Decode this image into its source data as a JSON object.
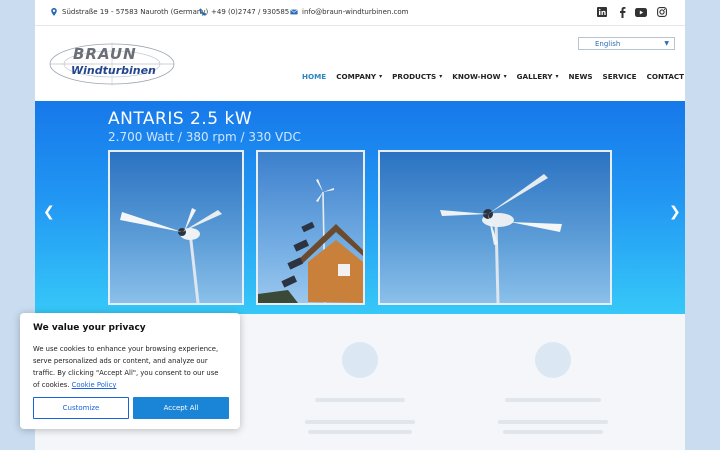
{
  "topbar": {
    "address": "Südstraße 19 - 57583 Nauroth (Germany)",
    "phone": "+49 (0)2747 / 930585",
    "email": "info@braun-windturbinen.com",
    "social": [
      "linkedin-icon",
      "facebook-icon",
      "youtube-icon",
      "instagram-icon"
    ]
  },
  "logo": {
    "line1": "BRAUN",
    "line2": "Windturbinen"
  },
  "language": {
    "selected": "English"
  },
  "nav": {
    "home": "HOME",
    "company": "COMPANY",
    "products": "PRODUCTS",
    "knowhow": "KNOW-HOW",
    "gallery": "GALLERY",
    "news": "NEWS",
    "service": "SERVICE",
    "contact": "CONTACT"
  },
  "hero": {
    "title": "ANTARIS 2.5 kW",
    "subtitle": "2.700 Watt / 380 rpm / 330 VDC"
  },
  "cookie": {
    "title": "We value your privacy",
    "text": "We use cookies to enhance your browsing experience, serve personalized ads or content, and analyze our traffic. By clicking \"Accept All\", you consent to our use of cookies.",
    "policy_link": "Cookie Policy",
    "customize": "Customize",
    "accept": "Accept All"
  },
  "colors": {
    "accent": "#2a86c4",
    "hero_top": "#1678ea",
    "hero_bottom": "#36c8f8",
    "button": "#1863dc"
  }
}
